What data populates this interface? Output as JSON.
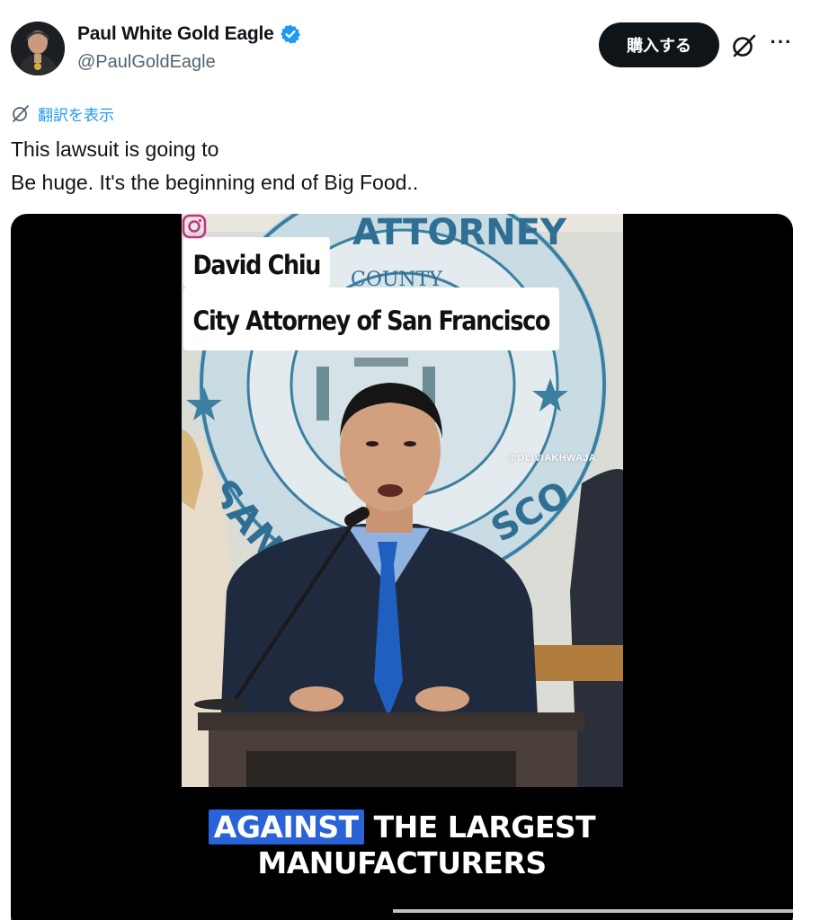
{
  "author": {
    "display_name": "Paul White Gold Eagle",
    "handle": "@PaulGoldEagle",
    "verified": true
  },
  "actions": {
    "buy_label": "購入する",
    "grok_icon": "grok-icon",
    "more_icon": "more-icon",
    "more_glyph": "···"
  },
  "translate": {
    "label": "翻訳を表示",
    "icon": "translate-icon"
  },
  "tweet": {
    "lines": [
      "This lawsuit is going to",
      "Be huge. It's the beginning end of Big Food.."
    ]
  },
  "video": {
    "lower_third": {
      "name": "David Chiu",
      "title": "City Attorney of San Francisco"
    },
    "watermark": "@OLIVIAKHWAJA",
    "seal_text": {
      "top": "ATTORNEY",
      "inner": "COUNTY",
      "left": "SAN",
      "right": "SCO"
    },
    "caption": {
      "highlight": "AGAINST",
      "line1_rest": "THE LARGEST",
      "line2": "MANUFACTURERS"
    }
  },
  "colors": {
    "accent": "#1d9bf0",
    "text": "#0f1419",
    "secondary": "#536471",
    "caption_highlight": "#2a62d8",
    "verified": "#1d9bf0"
  }
}
